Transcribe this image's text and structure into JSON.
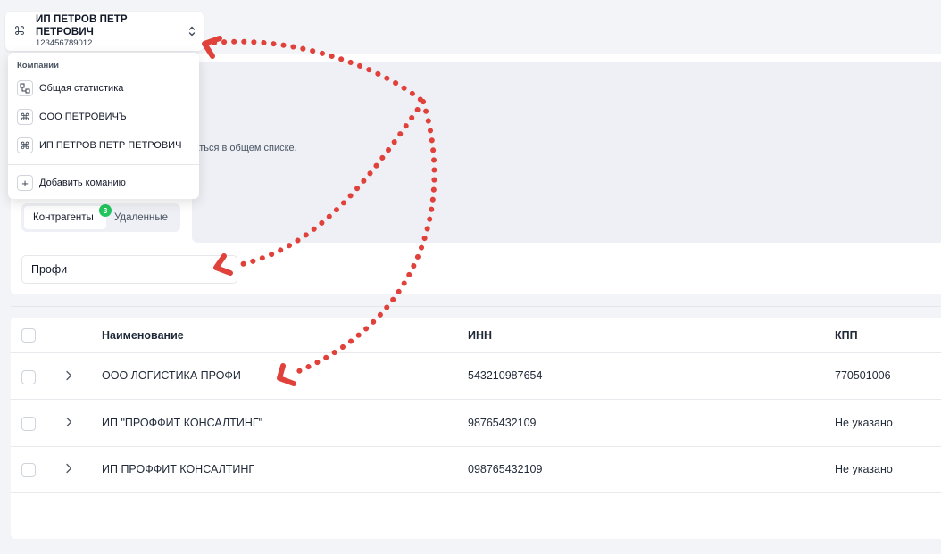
{
  "company_switcher": {
    "name": "ИП ПЕТРОВ ПЕТР ПЕТРОВИЧ",
    "inn": "123456789012"
  },
  "dropdown": {
    "header": "Компании",
    "items": [
      {
        "label": "Общая статистика",
        "icon": "stats-icon"
      },
      {
        "label": "ООО ПЕТРОВИЧЪ",
        "icon": "command-icon"
      },
      {
        "label": "ИП ПЕТРОВ ПЕТР ПЕТРОВИЧ",
        "icon": "command-icon"
      }
    ],
    "add_label": "Добавить команию"
  },
  "banner": {
    "text": "жаться в общем списке."
  },
  "tabs": [
    {
      "label": "Контрагенты",
      "badge": "3",
      "active": true
    },
    {
      "label": "Удаленные",
      "active": false
    }
  ],
  "search": {
    "value": "Профи"
  },
  "table": {
    "columns": [
      "Наименование",
      "ИНН",
      "КПП"
    ],
    "rows": [
      {
        "name": "ООО ЛОГИСТИКА ПРОФИ",
        "inn": "543210987654",
        "kpp": "770501006"
      },
      {
        "name": "ИП \"ПРОФФИТ КОНСАЛТИНГ\"",
        "inn": "98765432109",
        "kpp": "Не указано"
      },
      {
        "name": "ИП ПРОФФИТ КОНСАЛТИНГ",
        "inn": "098765432109",
        "kpp": "Не указано"
      }
    ]
  },
  "colors": {
    "badge": "#22c55e",
    "annotation_arrow": "#e0413a"
  }
}
